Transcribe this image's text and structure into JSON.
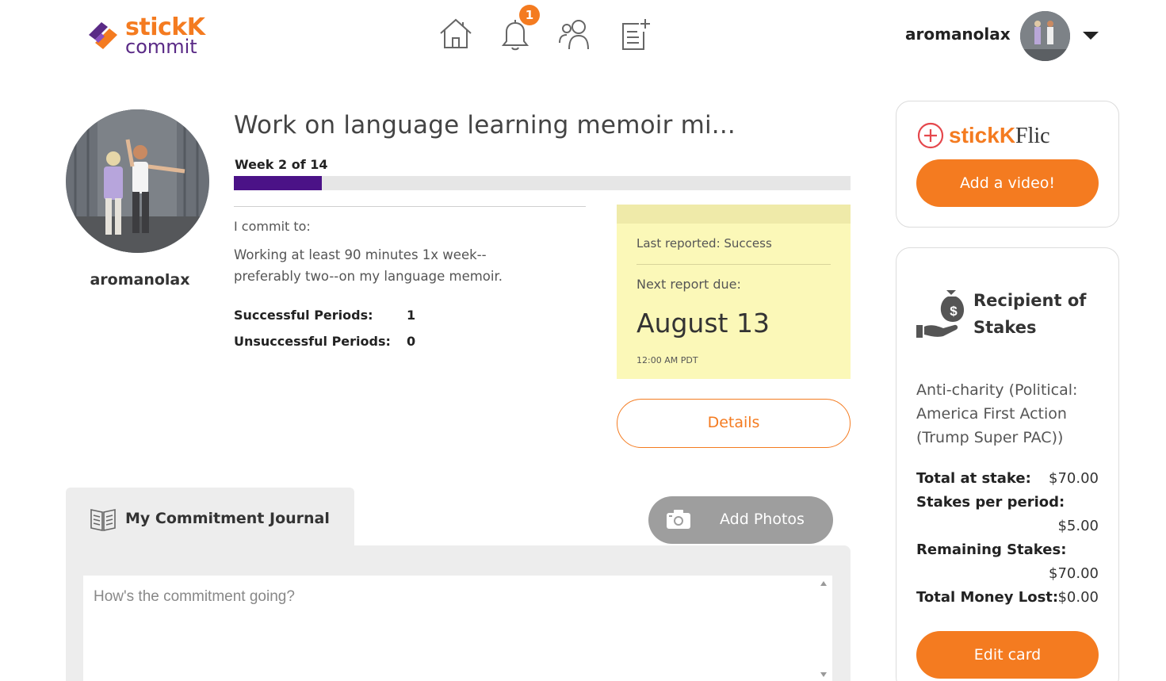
{
  "header": {
    "logo": {
      "line1": "stickK",
      "line2": "commit"
    },
    "nav": [
      "home-icon",
      "bell-icon",
      "people-icon",
      "new-commitment-icon"
    ],
    "notification_count": "1",
    "username": "aromanolax"
  },
  "profile": {
    "username": "aromanolax"
  },
  "commitment": {
    "title": "Work on language learning memoir mi...",
    "week_label": "Week 2 of 14",
    "progress_fraction": 0.1429,
    "commit_label": "I commit to:",
    "commit_text": "Working at least 90 minutes 1x week--preferably two--on my language memoir.",
    "stats": [
      {
        "label": "Successful Periods:",
        "value": "1"
      },
      {
        "label": "Unsuccessful Periods:",
        "value": "0"
      }
    ]
  },
  "report": {
    "last_reported": "Last reported: Success",
    "next_label": "Next report due:",
    "next_date": "August 13",
    "next_time": "12:00 AM PDT"
  },
  "details_button": "Details",
  "journal": {
    "tab_label": "My Commitment Journal",
    "add_photos": "Add Photos",
    "placeholder": "How's the commitment going?"
  },
  "flic": {
    "title_bold": "stickK",
    "title_rest": "Flic",
    "button": "Add a video!"
  },
  "stakes": {
    "title": "Recipient of Stakes",
    "recipient": "Anti-charity (Political: America First Action (Trump Super PAC))",
    "total_label": "Total at stake:",
    "total_value": "$70.00",
    "per_period_label": "Stakes per period:",
    "per_period_value": "$5.00",
    "remaining_label": "Remaining Stakes:",
    "remaining_value": "$70.00",
    "lost_label": "Total Money Lost:",
    "lost_value": "$0.00",
    "edit_button": "Edit card"
  },
  "colors": {
    "brand_orange": "#f47b20",
    "brand_purple": "#4b1287",
    "report_yellow": "#fbf8b8"
  }
}
